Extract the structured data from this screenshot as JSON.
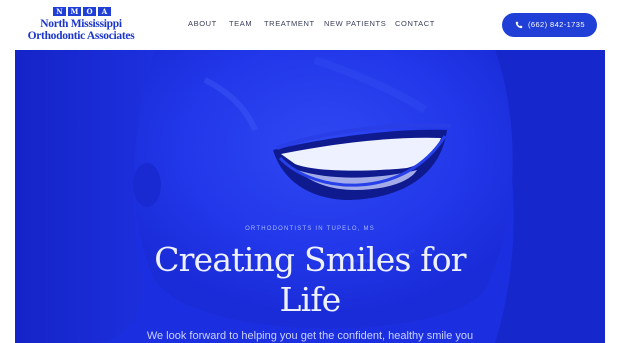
{
  "logo": {
    "badge_letters": [
      "N",
      "M",
      "O",
      "A"
    ],
    "line1": "North Mississippi",
    "line2": "Orthodontic Associates"
  },
  "nav": {
    "items": [
      {
        "label": "ABOUT"
      },
      {
        "label": "TEAM"
      },
      {
        "label": "TREATMENT"
      },
      {
        "label": "NEW PATIENTS"
      },
      {
        "label": "CONTACT"
      }
    ]
  },
  "phone": {
    "label": "(662) 842-1735",
    "icon": "phone-icon"
  },
  "hero": {
    "eyebrow": "ORTHODONTISTS IN TUPELO, MS",
    "title_line1": "Creating Smiles for",
    "title_line2": "Life",
    "subtitle": "We look forward to helping you get the confident, healthy smile you"
  },
  "colors": {
    "brand_blue": "#1f3fd6",
    "hero_blue": "#1b2fe6",
    "nav_text": "#3a3f5a"
  }
}
